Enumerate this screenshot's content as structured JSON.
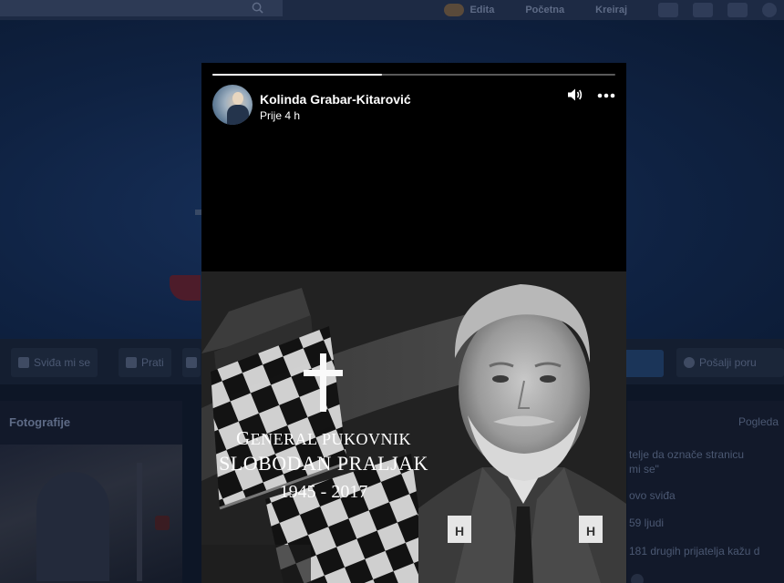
{
  "background_page": {
    "nav": {
      "user_name": "Edita",
      "home": "Početna",
      "create": "Kreiraj"
    },
    "actions": {
      "like": "Sviđa mi se",
      "follow": "Prati",
      "send_message": "Pošalji poru"
    },
    "photos": {
      "title": "Fotografije"
    },
    "sidebar": {
      "see_all": "Pogleda",
      "invite_line1": "telje da označe stranicu",
      "invite_line2": "mi se\"",
      "likes_label": "ovo sviđa",
      "people_count": "59 ljudi",
      "friends_line": "181 drugih prijatelja kažu d"
    }
  },
  "story": {
    "progress": 0.42,
    "author": "Kolinda Grabar-Kitarović",
    "timestamp": "Prije 4 h",
    "memorial": {
      "rank_initial": "G",
      "rank_rest": "ENERAL PUKOVNIK",
      "name": "SLOBODAN PRALJAK",
      "years": "1945 - 2017"
    }
  },
  "colors": {
    "story_bg": "#000000",
    "page_dim": "#0d1626",
    "progress_fill": "#ffffff"
  }
}
